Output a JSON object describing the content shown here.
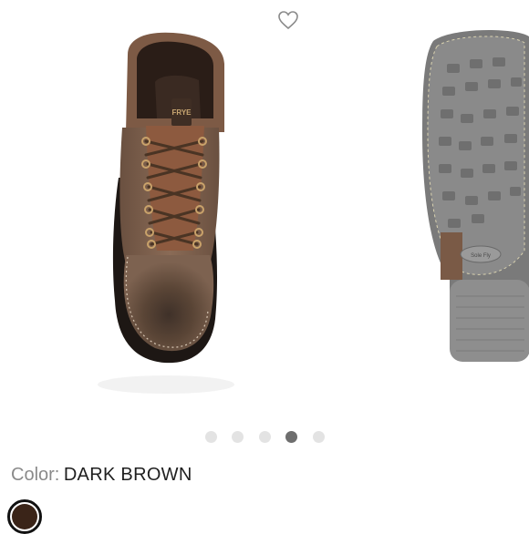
{
  "favorite": {
    "icon": "heart-outline-icon"
  },
  "gallery": {
    "slides": [
      {
        "subject": "boot-top-view",
        "tag_text": "FRYE"
      },
      {
        "subject": "boot-sole-view",
        "sole_logo_text": "Sole Fly"
      }
    ],
    "dots_total": 5,
    "active_dot_index": 3
  },
  "color": {
    "label": "Color:",
    "value": "DARK BROWN",
    "swatches": [
      {
        "hex": "#3a2418",
        "selected": true
      }
    ]
  },
  "colors": {
    "dot_inactive": "#e3e3e3",
    "dot_active": "#6e6e6e"
  }
}
